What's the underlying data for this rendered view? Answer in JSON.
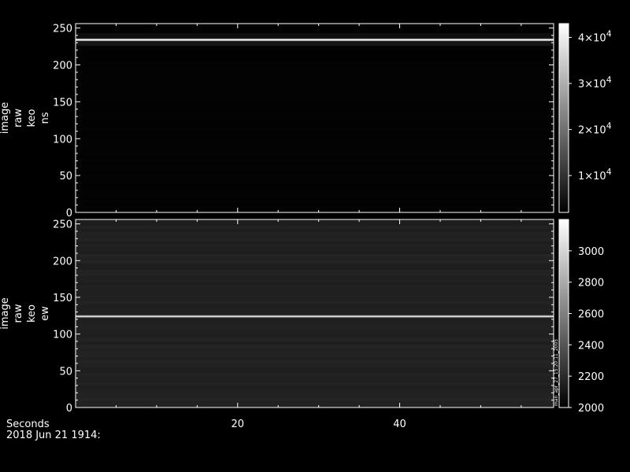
{
  "chart_data": [
    {
      "type": "heatmap",
      "ylabel_lines": [
        "image",
        "raw",
        "keo",
        "ns"
      ],
      "xlim": [
        0,
        59
      ],
      "ylim": [
        0,
        256
      ],
      "yticks": [
        0,
        50,
        100,
        150,
        200,
        250
      ],
      "xticks": [
        20,
        40
      ],
      "show_x_tick_labels": false,
      "background_level": 0.01,
      "features": [
        {
          "y": 234,
          "intensity": 1.0,
          "type": "bright-line"
        },
        {
          "y": 229,
          "intensity": 0.12,
          "type": "faint-band"
        },
        {
          "y": 240,
          "intensity": 0.08,
          "type": "faint-band"
        }
      ],
      "colorbar": {
        "range": [
          2000,
          43000
        ],
        "ticks": [
          {
            "value": 10000,
            "mant": "1",
            "exp": "4"
          },
          {
            "value": 20000,
            "mant": "2",
            "exp": "4"
          },
          {
            "value": 30000,
            "mant": "3",
            "exp": "4"
          },
          {
            "value": 40000,
            "mant": "4",
            "exp": "4"
          }
        ]
      }
    },
    {
      "type": "heatmap",
      "ylabel_lines": [
        "image",
        "raw",
        "keo",
        "ew"
      ],
      "xlim": [
        0,
        59
      ],
      "ylim": [
        0,
        256
      ],
      "yticks": [
        0,
        50,
        100,
        150,
        200,
        250
      ],
      "xticks": [
        20,
        40
      ],
      "show_x_tick_labels": true,
      "background_level": 0.13,
      "features": [
        {
          "y": 124,
          "intensity": 0.85,
          "type": "bright-line"
        }
      ],
      "colorbar": {
        "range": [
          2000,
          3200
        ],
        "ticks": [
          {
            "value": 2000,
            "label": "2000"
          },
          {
            "value": 2200,
            "label": "2200"
          },
          {
            "value": 2400,
            "label": "2400"
          },
          {
            "value": 2600,
            "label": "2600"
          },
          {
            "value": 2800,
            "label": "2800"
          },
          {
            "value": 3000,
            "label": "3000"
          }
        ],
        "side_note": "man_apr_27_15:20:11_2005"
      }
    }
  ],
  "footer": {
    "xlabel": "Seconds",
    "date": "2018 Jun 21 1914:"
  }
}
